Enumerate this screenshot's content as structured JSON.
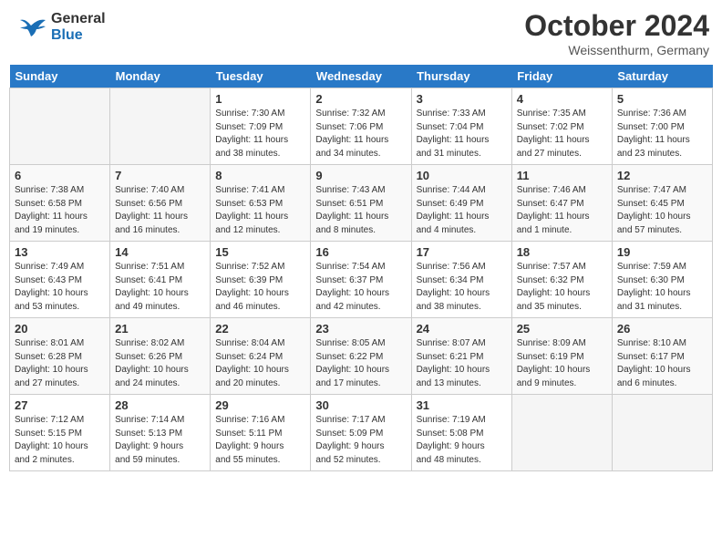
{
  "header": {
    "logo_general": "General",
    "logo_blue": "Blue",
    "title": "October 2024",
    "location": "Weissenthurm, Germany"
  },
  "days_of_week": [
    "Sunday",
    "Monday",
    "Tuesday",
    "Wednesday",
    "Thursday",
    "Friday",
    "Saturday"
  ],
  "weeks": [
    [
      {
        "day": "",
        "info": ""
      },
      {
        "day": "",
        "info": ""
      },
      {
        "day": "1",
        "info": "Sunrise: 7:30 AM\nSunset: 7:09 PM\nDaylight: 11 hours\nand 38 minutes."
      },
      {
        "day": "2",
        "info": "Sunrise: 7:32 AM\nSunset: 7:06 PM\nDaylight: 11 hours\nand 34 minutes."
      },
      {
        "day": "3",
        "info": "Sunrise: 7:33 AM\nSunset: 7:04 PM\nDaylight: 11 hours\nand 31 minutes."
      },
      {
        "day": "4",
        "info": "Sunrise: 7:35 AM\nSunset: 7:02 PM\nDaylight: 11 hours\nand 27 minutes."
      },
      {
        "day": "5",
        "info": "Sunrise: 7:36 AM\nSunset: 7:00 PM\nDaylight: 11 hours\nand 23 minutes."
      }
    ],
    [
      {
        "day": "6",
        "info": "Sunrise: 7:38 AM\nSunset: 6:58 PM\nDaylight: 11 hours\nand 19 minutes."
      },
      {
        "day": "7",
        "info": "Sunrise: 7:40 AM\nSunset: 6:56 PM\nDaylight: 11 hours\nand 16 minutes."
      },
      {
        "day": "8",
        "info": "Sunrise: 7:41 AM\nSunset: 6:53 PM\nDaylight: 11 hours\nand 12 minutes."
      },
      {
        "day": "9",
        "info": "Sunrise: 7:43 AM\nSunset: 6:51 PM\nDaylight: 11 hours\nand 8 minutes."
      },
      {
        "day": "10",
        "info": "Sunrise: 7:44 AM\nSunset: 6:49 PM\nDaylight: 11 hours\nand 4 minutes."
      },
      {
        "day": "11",
        "info": "Sunrise: 7:46 AM\nSunset: 6:47 PM\nDaylight: 11 hours\nand 1 minute."
      },
      {
        "day": "12",
        "info": "Sunrise: 7:47 AM\nSunset: 6:45 PM\nDaylight: 10 hours\nand 57 minutes."
      }
    ],
    [
      {
        "day": "13",
        "info": "Sunrise: 7:49 AM\nSunset: 6:43 PM\nDaylight: 10 hours\nand 53 minutes."
      },
      {
        "day": "14",
        "info": "Sunrise: 7:51 AM\nSunset: 6:41 PM\nDaylight: 10 hours\nand 49 minutes."
      },
      {
        "day": "15",
        "info": "Sunrise: 7:52 AM\nSunset: 6:39 PM\nDaylight: 10 hours\nand 46 minutes."
      },
      {
        "day": "16",
        "info": "Sunrise: 7:54 AM\nSunset: 6:37 PM\nDaylight: 10 hours\nand 42 minutes."
      },
      {
        "day": "17",
        "info": "Sunrise: 7:56 AM\nSunset: 6:34 PM\nDaylight: 10 hours\nand 38 minutes."
      },
      {
        "day": "18",
        "info": "Sunrise: 7:57 AM\nSunset: 6:32 PM\nDaylight: 10 hours\nand 35 minutes."
      },
      {
        "day": "19",
        "info": "Sunrise: 7:59 AM\nSunset: 6:30 PM\nDaylight: 10 hours\nand 31 minutes."
      }
    ],
    [
      {
        "day": "20",
        "info": "Sunrise: 8:01 AM\nSunset: 6:28 PM\nDaylight: 10 hours\nand 27 minutes."
      },
      {
        "day": "21",
        "info": "Sunrise: 8:02 AM\nSunset: 6:26 PM\nDaylight: 10 hours\nand 24 minutes."
      },
      {
        "day": "22",
        "info": "Sunrise: 8:04 AM\nSunset: 6:24 PM\nDaylight: 10 hours\nand 20 minutes."
      },
      {
        "day": "23",
        "info": "Sunrise: 8:05 AM\nSunset: 6:22 PM\nDaylight: 10 hours\nand 17 minutes."
      },
      {
        "day": "24",
        "info": "Sunrise: 8:07 AM\nSunset: 6:21 PM\nDaylight: 10 hours\nand 13 minutes."
      },
      {
        "day": "25",
        "info": "Sunrise: 8:09 AM\nSunset: 6:19 PM\nDaylight: 10 hours\nand 9 minutes."
      },
      {
        "day": "26",
        "info": "Sunrise: 8:10 AM\nSunset: 6:17 PM\nDaylight: 10 hours\nand 6 minutes."
      }
    ],
    [
      {
        "day": "27",
        "info": "Sunrise: 7:12 AM\nSunset: 5:15 PM\nDaylight: 10 hours\nand 2 minutes."
      },
      {
        "day": "28",
        "info": "Sunrise: 7:14 AM\nSunset: 5:13 PM\nDaylight: 9 hours\nand 59 minutes."
      },
      {
        "day": "29",
        "info": "Sunrise: 7:16 AM\nSunset: 5:11 PM\nDaylight: 9 hours\nand 55 minutes."
      },
      {
        "day": "30",
        "info": "Sunrise: 7:17 AM\nSunset: 5:09 PM\nDaylight: 9 hours\nand 52 minutes."
      },
      {
        "day": "31",
        "info": "Sunrise: 7:19 AM\nSunset: 5:08 PM\nDaylight: 9 hours\nand 48 minutes."
      },
      {
        "day": "",
        "info": ""
      },
      {
        "day": "",
        "info": ""
      }
    ]
  ]
}
